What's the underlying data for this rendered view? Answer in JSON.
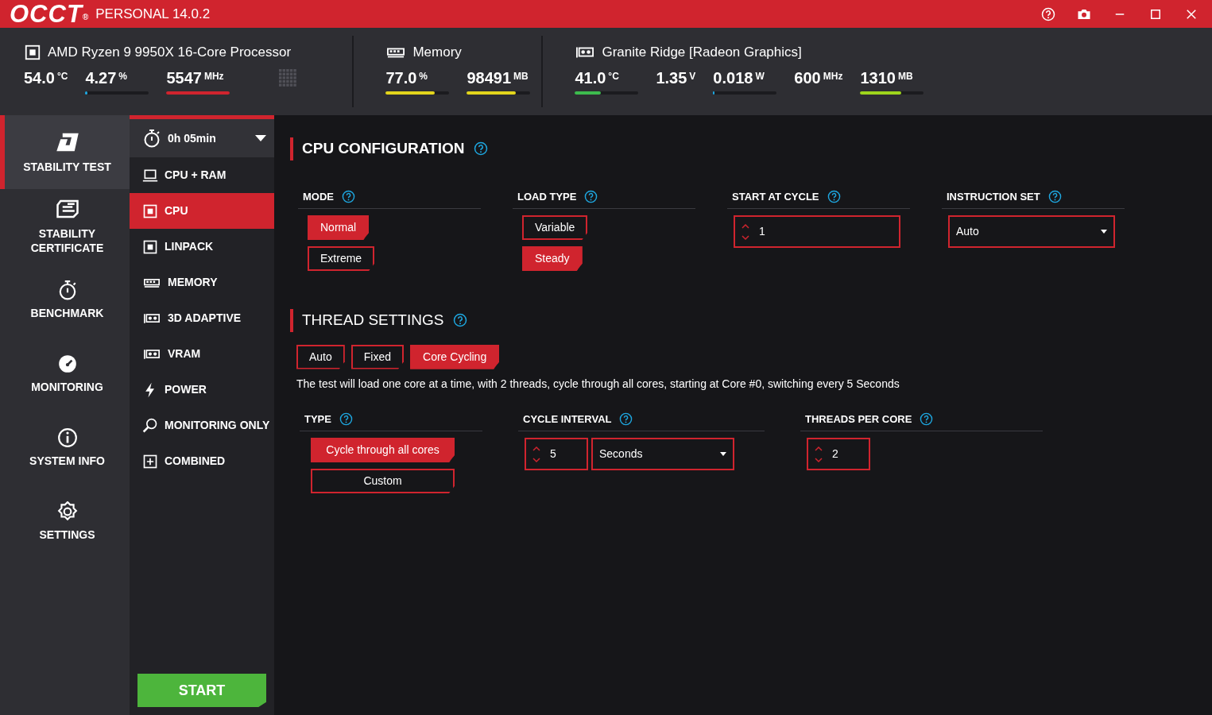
{
  "title_bar": {
    "logo": "OCCT",
    "registered": "®",
    "edition": "PERSONAL 14.0.2"
  },
  "header": {
    "devices": [
      {
        "kind": "cpu",
        "name": "AMD Ryzen 9 9950X 16-Core Processor",
        "metrics": [
          {
            "value": "54.0",
            "unit": "°C"
          },
          {
            "value": "4.27",
            "unit": "%",
            "level": 0.03,
            "color": "#1ea7e0"
          },
          {
            "value": "5547",
            "unit": "MHz",
            "level": 1.0,
            "color": "#d0242e"
          }
        ]
      },
      {
        "kind": "memory",
        "name": "Memory",
        "metrics": [
          {
            "value": "77.0",
            "unit": "%",
            "level": 0.77,
            "color": "#e3d51c"
          },
          {
            "value": "98491",
            "unit": "MB",
            "level": 0.77,
            "color": "#e3d51c"
          }
        ]
      },
      {
        "kind": "gpu",
        "name": "Granite Ridge [Radeon Graphics]",
        "metrics": [
          {
            "value": "41.0",
            "unit": "°C",
            "level": 0.41,
            "color": "#3dbb4e"
          },
          {
            "value": "1.35",
            "unit": "V"
          },
          {
            "value": "0.018",
            "unit": "W",
            "level": 0.02,
            "color": "#1ea7e0"
          },
          {
            "value": "600",
            "unit": "MHz"
          },
          {
            "value": "1310",
            "unit": "MB",
            "level": 0.65,
            "color": "#9ed51c"
          }
        ]
      }
    ]
  },
  "nav": {
    "items": [
      {
        "kind": "stability",
        "label": "STABILITY TEST",
        "selected": true
      },
      {
        "kind": "certificate",
        "label": "STABILITY CERTIFICATE",
        "selected": false
      },
      {
        "kind": "benchmark",
        "label": "BENCHMARK",
        "selected": false
      },
      {
        "kind": "monitoring",
        "label": "MONITORING",
        "selected": false
      },
      {
        "kind": "info",
        "label": "SYSTEM INFO",
        "selected": false
      },
      {
        "kind": "settings",
        "label": "SETTINGS",
        "selected": false
      }
    ]
  },
  "test_menu": {
    "duration": "0h 05min",
    "items": [
      {
        "kind": "laptop",
        "label": "CPU + RAM",
        "selected": false
      },
      {
        "kind": "chip",
        "label": "CPU",
        "selected": true
      },
      {
        "kind": "chip",
        "label": "LINPACK",
        "selected": false
      },
      {
        "kind": "memory",
        "label": "MEMORY",
        "selected": false
      },
      {
        "kind": "gpu",
        "label": "3D ADAPTIVE",
        "selected": false
      },
      {
        "kind": "gpu",
        "label": "VRAM",
        "selected": false
      },
      {
        "kind": "bolt",
        "label": "POWER",
        "selected": false
      },
      {
        "kind": "search",
        "label": "MONITORING ONLY",
        "selected": false
      },
      {
        "kind": "plus",
        "label": "COMBINED",
        "selected": false
      }
    ],
    "start_button": "START"
  },
  "cpu_configuration": {
    "title": "CPU CONFIGURATION",
    "groups": [
      {
        "kind": "options",
        "label": "MODE",
        "options": [
          {
            "label": "Normal",
            "selected": true
          },
          {
            "label": "Extreme",
            "selected": false
          }
        ]
      },
      {
        "kind": "options",
        "label": "LOAD TYPE",
        "options": [
          {
            "label": "Variable",
            "selected": false
          },
          {
            "label": "Steady",
            "selected": true
          }
        ]
      },
      {
        "kind": "spinner",
        "label": "START AT CYCLE",
        "value": "1"
      },
      {
        "kind": "select",
        "label": "INSTRUCTION SET",
        "value": "Auto"
      }
    ]
  },
  "thread_settings": {
    "title": "THREAD SETTINGS",
    "tabs": [
      {
        "label": "Auto",
        "selected": false
      },
      {
        "label": "Fixed",
        "selected": false
      },
      {
        "label": "Core Cycling",
        "selected": true
      }
    ],
    "description": "The test will load one core at a time, with 2 threads, cycle through all cores, starting at Core #0, switching every 5 Seconds",
    "groups": [
      {
        "kind": "options",
        "label": "TYPE",
        "options": [
          {
            "label": "Cycle through all cores",
            "selected": true
          },
          {
            "label": "Custom",
            "selected": false
          }
        ]
      },
      {
        "kind": "interval",
        "label": "CYCLE INTERVAL",
        "value": "5",
        "unit": "Seconds"
      },
      {
        "kind": "spinner",
        "label": "THREADS PER CORE",
        "value": "2"
      }
    ]
  }
}
